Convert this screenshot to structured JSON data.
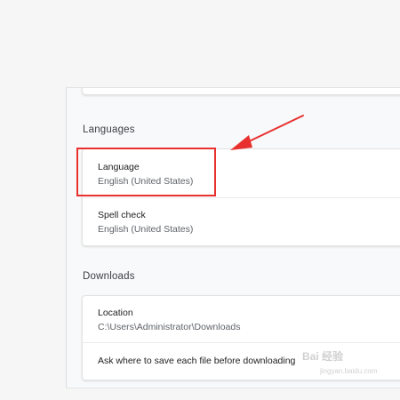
{
  "sections": {
    "languages": {
      "title": "Languages",
      "rows": [
        {
          "label": "Language",
          "value": "English (United States)"
        },
        {
          "label": "Spell check",
          "value": "English (United States)"
        }
      ]
    },
    "downloads": {
      "title": "Downloads",
      "rows": [
        {
          "label": "Location",
          "value": "C:\\Users\\Administrator\\Downloads"
        },
        {
          "label": "Ask where to save each file before downloading"
        }
      ]
    }
  },
  "annotation": {
    "highlight_color": "#e8312f",
    "arrow_color": "#e8312f"
  },
  "watermark": {
    "text": "Bai 经验",
    "url": "jingyan.baidu.com"
  }
}
